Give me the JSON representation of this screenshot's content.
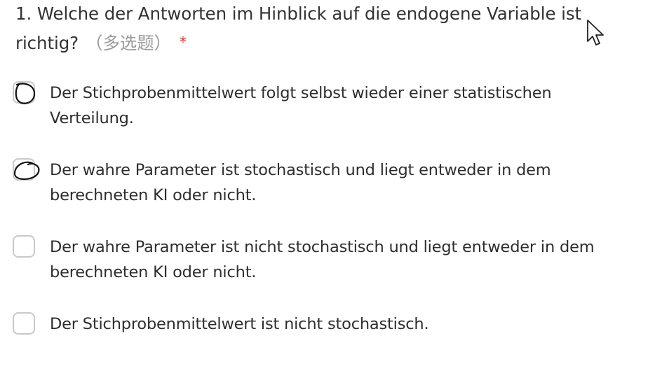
{
  "question": {
    "number_and_text": "1. Welche der Antworten im Hinblick auf die endogene Variable ist richtig?",
    "type_label": "（多选题）",
    "required_marker": "*"
  },
  "options": [
    {
      "label": "Der Stichprobenmittelwert folgt selbst wieder einer statistischen Verteilung.",
      "checked": false,
      "annotated": true
    },
    {
      "label": "Der wahre Parameter ist stochastisch und liegt entweder in dem berechneten KI oder nicht.",
      "checked": false,
      "annotated": true
    },
    {
      "label": "Der wahre Parameter ist nicht stochastisch und liegt entweder in dem berechneten KI oder nicht.",
      "checked": false,
      "annotated": false
    },
    {
      "label": "Der Stichprobenmittelwert ist nicht stochastisch.",
      "checked": false,
      "annotated": false
    }
  ],
  "colors": {
    "required": "#e0322e",
    "type_label": "#9a9a9a",
    "checkbox_border": "#c9c9c9",
    "annotation_ink": "#111111"
  },
  "icons": {
    "cursor": "mouse-pointer-icon",
    "annotation": "hand-drawn-circle-icon"
  }
}
